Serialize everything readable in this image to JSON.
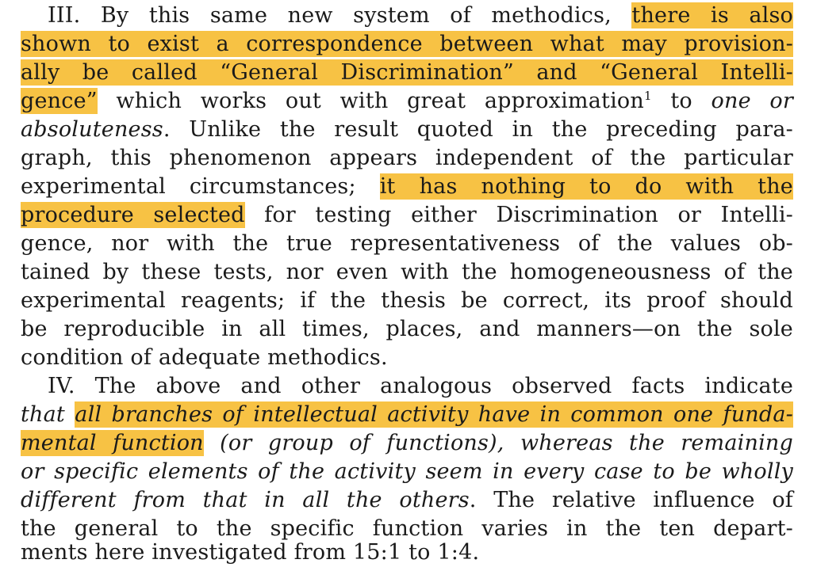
{
  "lines": [
    {
      "a": "III.  By this same new system of methodics, ",
      "hl": "there is also"
    },
    {
      "hl": "shown to exist a correspondence between what may provision-"
    },
    {
      "hl": "ally be called “General Discrimination” and “General Intelli-"
    },
    {
      "hl": "gence”",
      "a": " which works out with great approximation",
      "sup": "1",
      "b": " to ",
      "i": "one or"
    },
    {
      "i": "absoluteness",
      "a": ".  Unlike the result quoted in the preceding para-"
    },
    {
      "a": "graph, this phenomenon appears independent of the particular"
    },
    {
      "a": "experimental circumstances; ",
      "hl": "it has nothing to do with the"
    },
    {
      "hl": "procedure selected",
      "a": " for testing either Discrimination or Intelli-"
    },
    {
      "a": "gence, nor with the true representativeness of the values ob-"
    },
    {
      "a": "tained by these tests, nor even with the homogeneousness of the"
    },
    {
      "a": "experimental reagents; if the thesis be correct, its proof should"
    },
    {
      "a": "be reproducible in all times, places, and manners—on the sole"
    },
    {
      "a": "condition of adequate methodics."
    },
    {
      "a": "IV.  The above and other analogous observed facts indicate"
    },
    {
      "i": "that ",
      "hl": "all branches of intellectual activity have in common one funda-"
    },
    {
      "hl": "mental function",
      "a": " (or group of functions), whereas the remaining"
    },
    {
      "i": "or specific elements of the activity seem in every case to be wholly"
    },
    {
      "i": "different from that in all the others",
      "a": ".  The relative influence of"
    },
    {
      "a": "the general to the specific function varies in the ten depart-"
    },
    {
      "a": "ments here investigated from 15:1 to 1:4."
    }
  ]
}
